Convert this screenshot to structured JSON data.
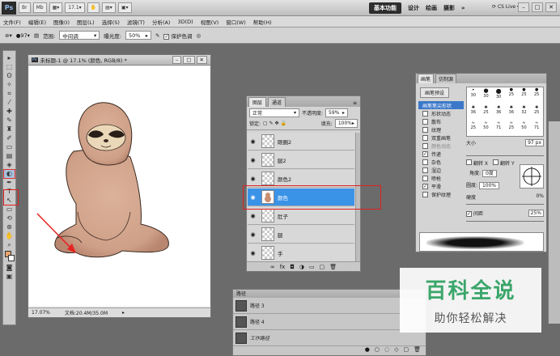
{
  "app": {
    "logo": "Ps",
    "zoom": "17.1",
    "workspaces": [
      "基本功能",
      "设计",
      "绘画",
      "摄影"
    ],
    "active_workspace": "基本功能",
    "more": "»",
    "cs_live": "CS Live"
  },
  "menu": [
    "文件(F)",
    "编辑(E)",
    "图像(I)",
    "图层(L)",
    "选择(S)",
    "滤镜(T)",
    "分析(A)",
    "3D(D)",
    "视图(V)",
    "窗口(W)",
    "帮助(H)"
  ],
  "options": {
    "brush_size": "97",
    "range_label": "范围:",
    "range_value": "中间调",
    "exposure_label": "曝光度:",
    "exposure_value": "50%",
    "protect_label": "保护色调"
  },
  "document": {
    "title": "未标题-1 @ 17.1% (颜色, RGB/8) *",
    "status_zoom": "17.07%",
    "status_doc": "文档:20.4M/35.0M"
  },
  "layers": {
    "tabs": [
      "图层",
      "通道"
    ],
    "blend_mode": "正常",
    "opacity_label": "不透明度:",
    "opacity": "59%",
    "lock_label": "锁定:",
    "fill_label": "填充:",
    "fill": "100%",
    "items": [
      {
        "name": "眼圈2",
        "active": false
      },
      {
        "name": "腿2",
        "active": false
      },
      {
        "name": "颜色2",
        "active": false
      },
      {
        "name": "颜色",
        "active": true
      },
      {
        "name": "肚子",
        "active": false
      },
      {
        "name": "腿",
        "active": false
      },
      {
        "name": "手",
        "active": false
      }
    ]
  },
  "brush": {
    "tabs": [
      "画笔",
      "仿制源"
    ],
    "preset_button": "画笔预设",
    "options": [
      "画笔笔尖形状",
      "形状动态",
      "散布",
      "纹理",
      "双重画笔",
      "颜色动态",
      "传递",
      "杂色",
      "湿边",
      "喷枪",
      "平滑",
      "保护纹理"
    ],
    "size_label": "大小",
    "size": "97 px",
    "flip_x": "翻转 X",
    "flip_y": "翻转 Y",
    "angle_label": "角度:",
    "angle": "0度",
    "roundness_label": "圆度:",
    "roundness": "100%",
    "hardness_label": "硬度",
    "hardness": "0%",
    "spacing_label": "间距",
    "spacing": "25%",
    "tip_sizes": [
      "30",
      "30",
      "30",
      "25",
      "25",
      "25",
      "36",
      "25",
      "36",
      "36",
      "32",
      "25",
      "25",
      "50",
      "71",
      "25",
      "50",
      "71"
    ]
  },
  "paths": {
    "tab": "路径",
    "items": [
      "路径 3",
      "路径 4",
      "工作路径"
    ]
  },
  "watermark": {
    "title": "百科全说",
    "subtitle": "助你轻松解决"
  },
  "colors": {
    "layer_active": "#3b93e8",
    "highlight_box": "#e02020",
    "sloth_fur": "#d6a98f",
    "watermark_green": "#3aa66a"
  }
}
